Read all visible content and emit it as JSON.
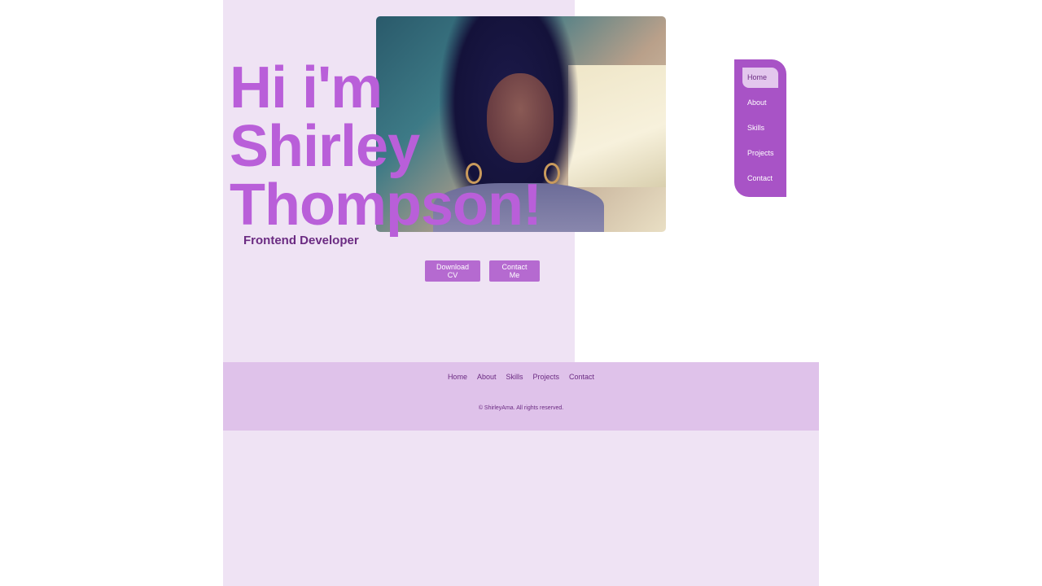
{
  "hero": {
    "title_line1": "Hi i'm",
    "title_line2": "Shirley",
    "title_line3": "Thompson!",
    "subtitle": "Frontend Developer"
  },
  "buttons": {
    "download_cv": "Download CV",
    "contact_me": "Contact Me"
  },
  "side_nav": {
    "items": [
      {
        "label": "Home",
        "active": true
      },
      {
        "label": "About",
        "active": false
      },
      {
        "label": "Skills",
        "active": false
      },
      {
        "label": "Projects",
        "active": false
      },
      {
        "label": "Contact",
        "active": false
      }
    ]
  },
  "footer": {
    "links": [
      "Home",
      "About",
      "Skills",
      "Projects",
      "Contact"
    ],
    "copyright": "© ShirleyAma. All rights reserved."
  },
  "colors": {
    "accent": "#b95fd9",
    "nav_bg": "#a853c6",
    "panel_bg": "#efe3f4",
    "footer_bg": "#dfc2ea",
    "text_dark": "#6b2b82"
  }
}
